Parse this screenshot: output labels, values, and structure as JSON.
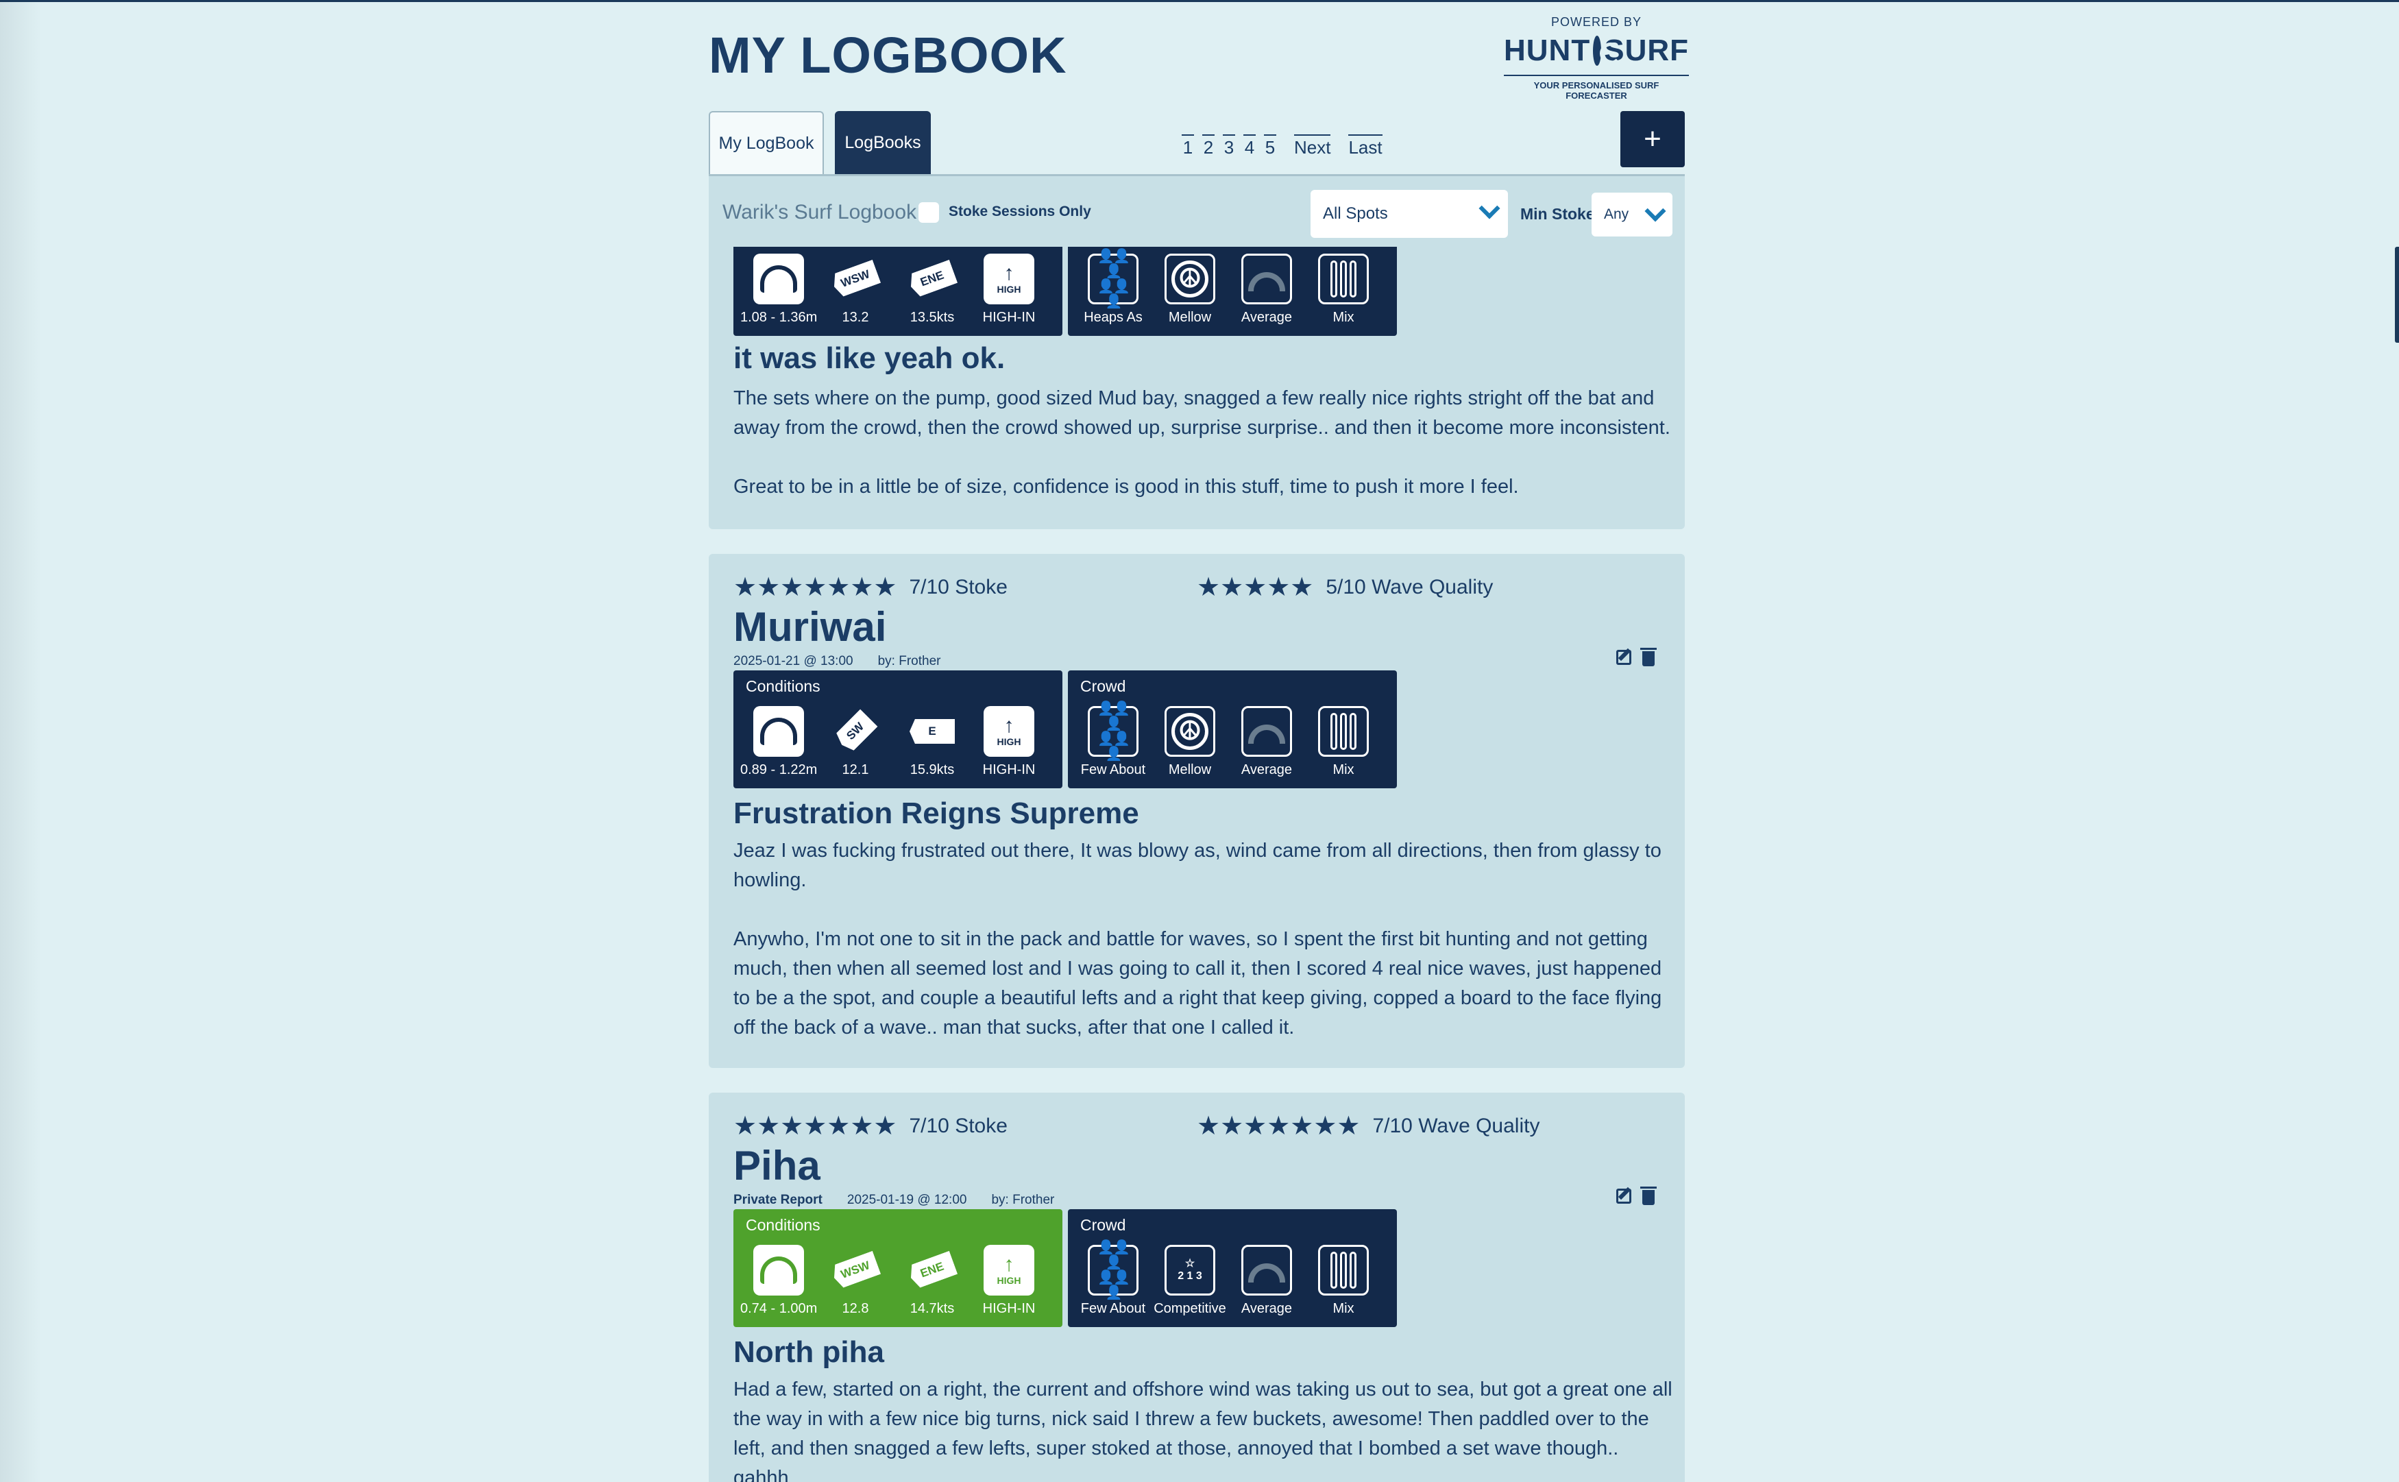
{
  "page": {
    "title": "MY LOGBOOK"
  },
  "brand": {
    "powered_by": "POWERED BY",
    "name_left": "HUNT",
    "name_right": "SURF",
    "tagline": "YOUR PERSONALISED SURF FORECASTER"
  },
  "tabs": [
    {
      "label": "My LogBook",
      "active": false
    },
    {
      "label": "LogBooks",
      "active": true
    }
  ],
  "pagination": {
    "pages": [
      "1",
      "2",
      "3",
      "4",
      "5"
    ],
    "next": "Next",
    "last": "Last"
  },
  "add_button": "+",
  "filters": {
    "logbook_name": "Warik's Surf Logbook",
    "stoke_only_label": "Stoke Sessions Only",
    "stoke_only_checked": false,
    "spot_value": "All Spots",
    "min_stoke_label": "Min Stoke",
    "min_stoke_value": "Any"
  },
  "entries": [
    {
      "conditions": {
        "swell": "1.08 - 1.36m",
        "swell_dir": "WSW",
        "period": "13.2",
        "wind_dir": "ENE",
        "wind": "13.5kts",
        "tide_icon": "HIGH",
        "tide": "HIGH-IN"
      },
      "crowd": {
        "crowd": "Heaps As",
        "vibe": "Mellow",
        "skill": "Average",
        "boards": "Mix"
      },
      "post_title": "it was like yeah ok.",
      "post_body": [
        "The sets where on the pump, good sized Mud bay, snagged a few really nice rights stright off the bat and away from the crowd, then the crowd showed up, surprise surprise.. and then it become more inconsistent.",
        "Great to be in a little be of size, confidence is good in this stuff, time to push it more I feel."
      ]
    },
    {
      "stoke": "7/10 Stoke",
      "stoke_stars": "★★★★★★★",
      "wave_quality": "5/10 Wave Quality",
      "wave_stars": "★★★★★",
      "spot": "Muriwai",
      "date": "2025-01-21 @ 13:00",
      "by": "by: Frother",
      "conditions_title": "Conditions",
      "crowd_title": "Crowd",
      "conditions": {
        "swell": "0.89 - 1.22m",
        "swell_dir": "SW",
        "period": "12.1",
        "wind_dir": "E",
        "wind": "15.9kts",
        "tide_icon": "HIGH",
        "tide": "HIGH-IN"
      },
      "crowd": {
        "crowd": "Few About",
        "vibe": "Mellow",
        "skill": "Average",
        "boards": "Mix"
      },
      "post_title": "Frustration Reigns Supreme",
      "post_body": [
        "Jeaz I was fucking frustrated out there, It was blowy as, wind came from all directions, then from glassy to howling.",
        "Anywho, I'm not one to sit in the pack and battle for waves, so I spent the first bit hunting and not getting much, then when all seemed lost and I was going to call it, then I scored 4 real nice waves, just happened to be a the spot, and couple a beautiful lefts and a right that keep giving, copped a board to the face flying off the back of a wave.. man that sucks, after that one I called it."
      ]
    },
    {
      "stoke": "7/10 Stoke",
      "stoke_stars": "★★★★★★★",
      "wave_quality": "7/10 Wave Quality",
      "wave_stars": "★★★★★★★",
      "spot": "Piha",
      "private": "Private Report",
      "date": "2025-01-19 @ 12:00",
      "by": "by: Frother",
      "conditions_title": "Conditions",
      "crowd_title": "Crowd",
      "conditions_color": "#4fa22c",
      "conditions": {
        "swell": "0.74 - 1.00m",
        "swell_dir": "WSW",
        "period": "12.8",
        "wind_dir": "ENE",
        "wind": "14.7kts",
        "tide_icon": "HIGH",
        "tide": "HIGH-IN"
      },
      "crowd": {
        "crowd": "Few About",
        "vibe": "Competitive",
        "skill": "Average",
        "boards": "Mix"
      },
      "post_title": "North piha",
      "post_body": [
        "Had a few, started on a right, the current and offshore wind was taking us out to sea, but got a great one all the way in with a few nice big turns, nick said I threw a few buckets, awesome! Then paddled over to the left, and then snagged a few lefts, super stoked at those, annoyed that I bombed a set wave though.. gahhh"
      ]
    }
  ],
  "colors": {
    "navy": "#13294a",
    "accent_blue": "#1a7bb5",
    "card_bg": "#c8e0e6",
    "page_bg": "#dff0f3",
    "good_conditions": "#4fa22c"
  }
}
